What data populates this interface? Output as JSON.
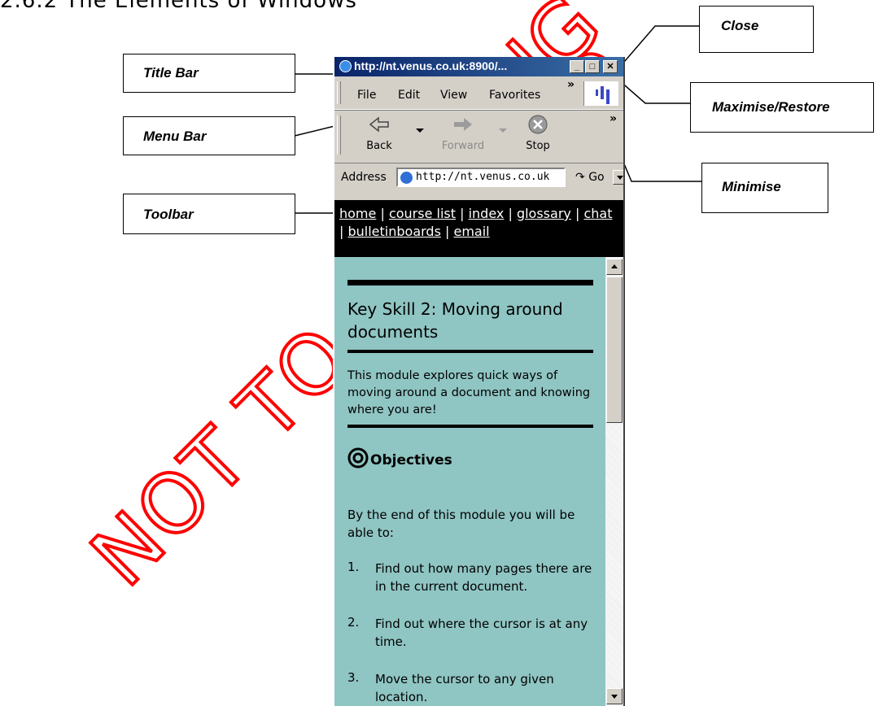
{
  "heading": "2.6.2   The Elements of Windows",
  "callouts": {
    "title_bar": "Title Bar",
    "menu_bar": "Menu Bar",
    "toolbar": "Toolbar",
    "close": "Close",
    "maximise_restore": "Maximise/Restore",
    "minimise": "Minimise"
  },
  "window": {
    "title": "http://nt.venus.co.uk:8900/...",
    "menu": [
      "File",
      "Edit",
      "View",
      "Favorites"
    ],
    "chevron": "»",
    "toolbar": {
      "back": "Back",
      "forward": "Forward",
      "stop": "Stop"
    },
    "address_label": "Address",
    "address_value": "http://nt.venus.co.uk",
    "go_label": "Go",
    "nav_links": [
      "home",
      "course list",
      "index",
      "glossary",
      "chat",
      "bulletinboards",
      "email"
    ],
    "separator": "|"
  },
  "page": {
    "title": "Key Skill 2: Moving around documents",
    "intro": "This module explores quick ways of moving around a document and knowing where you are!",
    "objectives_heading": "Objectives",
    "lead": "By the end of this module you will be able to:",
    "items": [
      {
        "num": "1.",
        "text": "Find out how many pages there are in the current document."
      },
      {
        "num": "2.",
        "text": "Find out where the cursor is at any time."
      },
      {
        "num": "3.",
        "text": "Move the cursor to any given location."
      }
    ]
  },
  "watermark": "NOT TO BE USED",
  "watermark_fragment": "NG"
}
